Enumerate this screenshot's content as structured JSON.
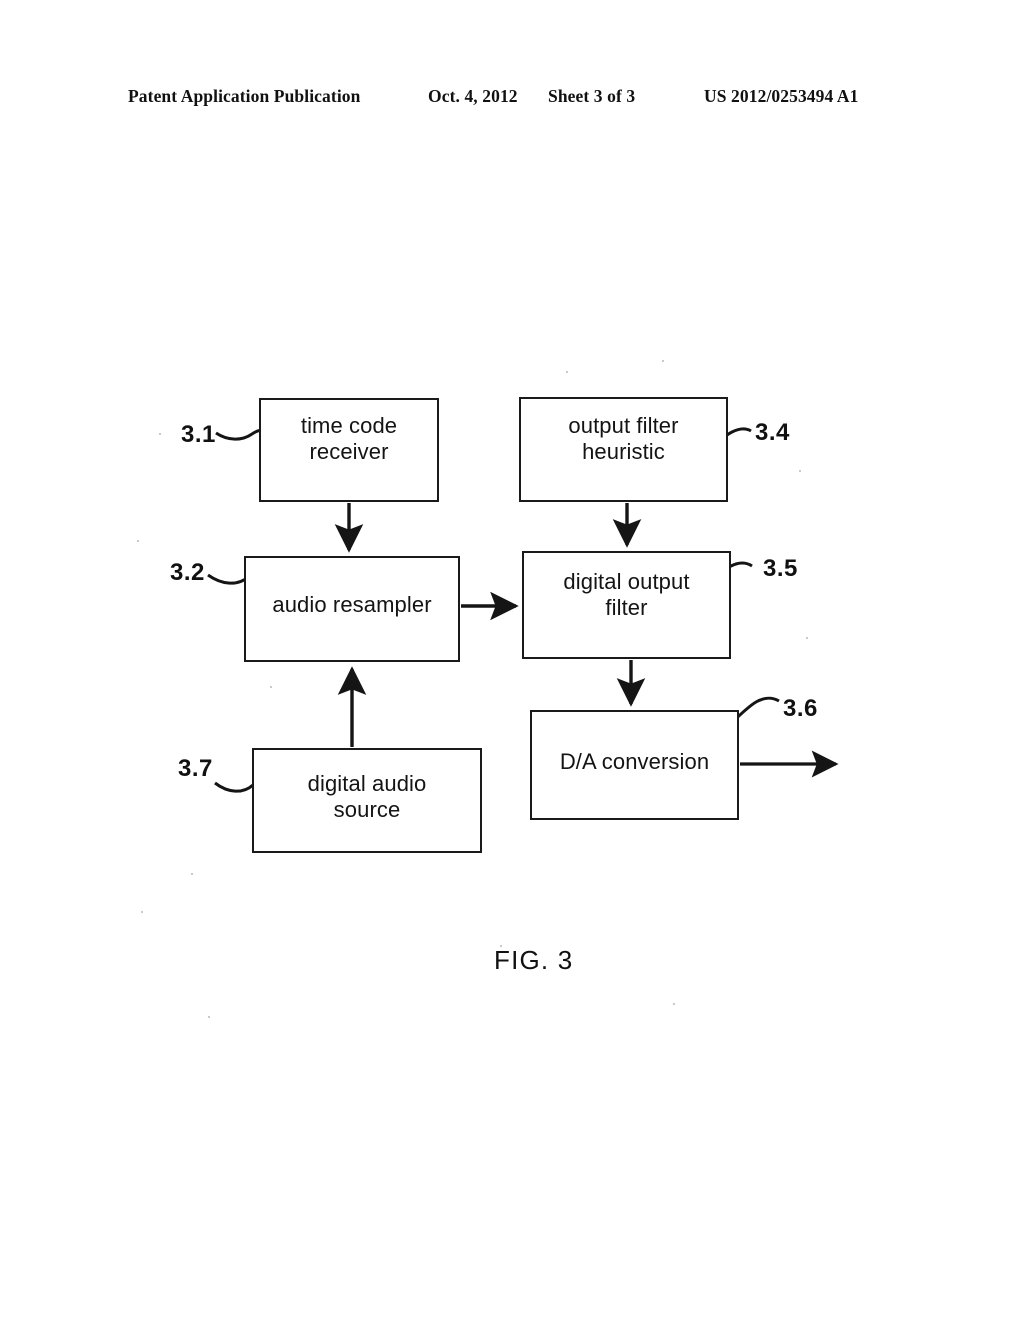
{
  "header": {
    "publication": "Patent Application Publication",
    "date": "Oct. 4, 2012",
    "sheet": "Sheet 3 of 3",
    "publication_number": "US 2012/0253494 A1"
  },
  "figure": {
    "caption": "FIG. 3",
    "nodes": [
      {
        "ref": "3.1",
        "label": "time code\nreceiver"
      },
      {
        "ref": "3.2",
        "label": "audio resampler"
      },
      {
        "ref": "3.4",
        "label": "output filter\nheuristic"
      },
      {
        "ref": "3.5",
        "label": "digital output\nfilter"
      },
      {
        "ref": "3.6",
        "label": "D/A conversion"
      },
      {
        "ref": "3.7",
        "label": "digital audio\nsource"
      }
    ],
    "connections": [
      {
        "from": "3.1",
        "to": "3.2",
        "direction": "down"
      },
      {
        "from": "3.4",
        "to": "3.5",
        "direction": "down"
      },
      {
        "from": "3.2",
        "to": "3.5",
        "direction": "right"
      },
      {
        "from": "3.7",
        "to": "3.2",
        "direction": "up"
      },
      {
        "from": "3.5",
        "to": "3.6",
        "direction": "down"
      },
      {
        "from": "3.6",
        "to": "output",
        "direction": "right"
      }
    ]
  },
  "colors": {
    "ink": "#1a1a1a",
    "paper": "#ffffff"
  }
}
